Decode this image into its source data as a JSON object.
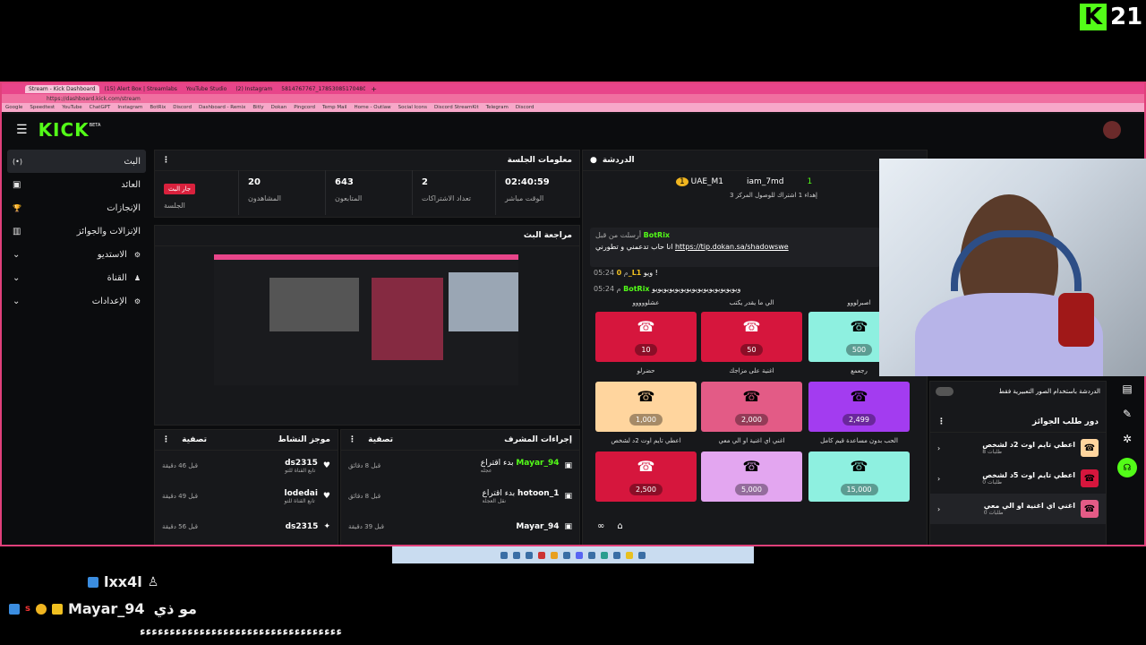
{
  "overlay": {
    "logo_letter": "K",
    "viewer_number": "21"
  },
  "browser": {
    "tabs": [
      "Stream - Kick Dashboard",
      "(15) Alert Box | Streamlabs",
      "YouTube Studio",
      "(2) Instagram",
      "5814767767_1785308517048065"
    ],
    "url": "https://dashboard.kick.com/stream",
    "bookmarks": [
      "Google",
      "Speedtest",
      "YouTube",
      "ChatGPT",
      "Instagram",
      "BotRix",
      "Discord",
      "Dashboard - Remix",
      "Bitly",
      "Dokan",
      "Pingcord",
      "Temp Mail",
      "Home - Outlaw",
      "Social Icons",
      "Discord StreamKit",
      "Telegram",
      "Discord"
    ]
  },
  "kick": {
    "logo": "KICK",
    "beta": "BETA",
    "sidebar": [
      {
        "label": "البث",
        "icon": "(•)",
        "active": true
      },
      {
        "label": "العائد",
        "icon": "▣"
      },
      {
        "label": "الإنجازات",
        "icon": "🏆"
      },
      {
        "label": "الإنزالات والجوائز",
        "icon": "▥"
      },
      {
        "label": "الاستديو",
        "icon": "⚙",
        "expand": true
      },
      {
        "label": "القناة",
        "icon": "♟",
        "expand": true
      },
      {
        "label": "الإعدادات",
        "icon": "⚙",
        "expand": true
      }
    ],
    "session": {
      "title": "معلومات الجلسة",
      "live_badge": "جار البث",
      "session_label": "الجلسة",
      "stats": [
        {
          "value": "20",
          "label": "المشاهدون"
        },
        {
          "value": "643",
          "label": "المتابعون"
        },
        {
          "value": "2",
          "label": "تعداد الاشتراكات"
        },
        {
          "value": "02:40:59",
          "label": "الوقت مباشر"
        }
      ]
    },
    "preview": {
      "title": "مراجعة البث"
    },
    "activity": {
      "title": "موجز النشاط",
      "filter": "تصفية",
      "rows": [
        {
          "user": "ds2315",
          "sub": "تابع القناة للتو",
          "time": "قبل 46 دقيقة"
        },
        {
          "user": "lodedai",
          "sub": "تابع القناة للتو",
          "time": "قبل 49 دقيقة"
        },
        {
          "user": "ds2315",
          "sub": "",
          "time": "قبل 56 دقيقة"
        }
      ]
    },
    "mod": {
      "title": "إجراءات المشرف",
      "filter": "تصفية",
      "rows": [
        {
          "user": "Mayar_94",
          "action": "بدء اقتراع",
          "sub": "عجله",
          "time": "قبل 8 دقائق"
        },
        {
          "user": "hotoon_1",
          "action": "بدء اقتراع",
          "sub": "نقل العجلة",
          "time": "قبل 8 دقائق"
        },
        {
          "user": "Mayar_94",
          "action": "",
          "sub": "",
          "time": "قبل 39 دقيقة"
        }
      ]
    },
    "chat": {
      "title": "الدردشة",
      "top_users": [
        "UAE_M1",
        "iam_7md"
      ],
      "top_counts": [
        "1",
        "1",
        "1"
      ],
      "goal_text": "إهداء 1 اشتراك للوصول المركز 3",
      "sent_by": "أرسلت من قبل",
      "bot": "BotRix",
      "bot_msg": "انا حاب تدعمني و تطورني",
      "bot_link": "https://tip.dokan.sa/shadowswe",
      "messages": [
        {
          "time": "05:24 م",
          "user": "0_L1",
          "text": "ويو !"
        },
        {
          "time": "05:24 م",
          "user": "BotRix",
          "text": "ويويويويويويويويويويويويويويويو"
        }
      ]
    },
    "tiles": [
      {
        "label": "عشلووووو",
        "price": "10",
        "color": "#d6163d"
      },
      {
        "label": "الي ما يقدر يكتب",
        "price": "50",
        "color": "#d6163d"
      },
      {
        "label": "اصبرلووو",
        "price": "500",
        "color": "#8ef0e0"
      },
      {
        "label": "حضرلو",
        "price": "1,000",
        "color": "#ffd59e"
      },
      {
        "label": "اغنية على مزاجك",
        "price": "2,000",
        "color": "#e35b86"
      },
      {
        "label": "رجعمع",
        "price": "2,499",
        "color": "#a33cf0"
      },
      {
        "label": "اعطي تايم اوت 2د لشخص",
        "price": "2,500",
        "color": "#d6163d"
      },
      {
        "label": "اغني اي اغنية او الي معي",
        "price": "5,000",
        "color": "#e3a6f0"
      },
      {
        "label": "الحب بدون مساعدة قيم كامل",
        "price": "15,000",
        "color": "#8ef0e0"
      }
    ],
    "chat_emote_toggle": "الدردشة باستخدام الصور التعبيرية فقط",
    "rewards": {
      "title": "دور طلب الجوائز",
      "rows": [
        {
          "label": "اعطي تايم اوت 2د لشخص",
          "sub": "طلبات 8",
          "color": "#ffd59e"
        },
        {
          "label": "اعطي تايم اوت 5د لشخص",
          "sub": "طلبات 0",
          "color": "#d6163d"
        },
        {
          "label": "اغني اي اغنية او الي معي",
          "sub": "طلبات 0",
          "color": "#e35b86"
        }
      ]
    }
  },
  "stream_chat": {
    "line1_user": "lxx4l",
    "line2_user": "Mayar_94",
    "line2_text": "مو ذي",
    "line3_text": "ءءءءءءءءءءءءءءءءءءءءءءءءءءءءءءءءءء"
  }
}
